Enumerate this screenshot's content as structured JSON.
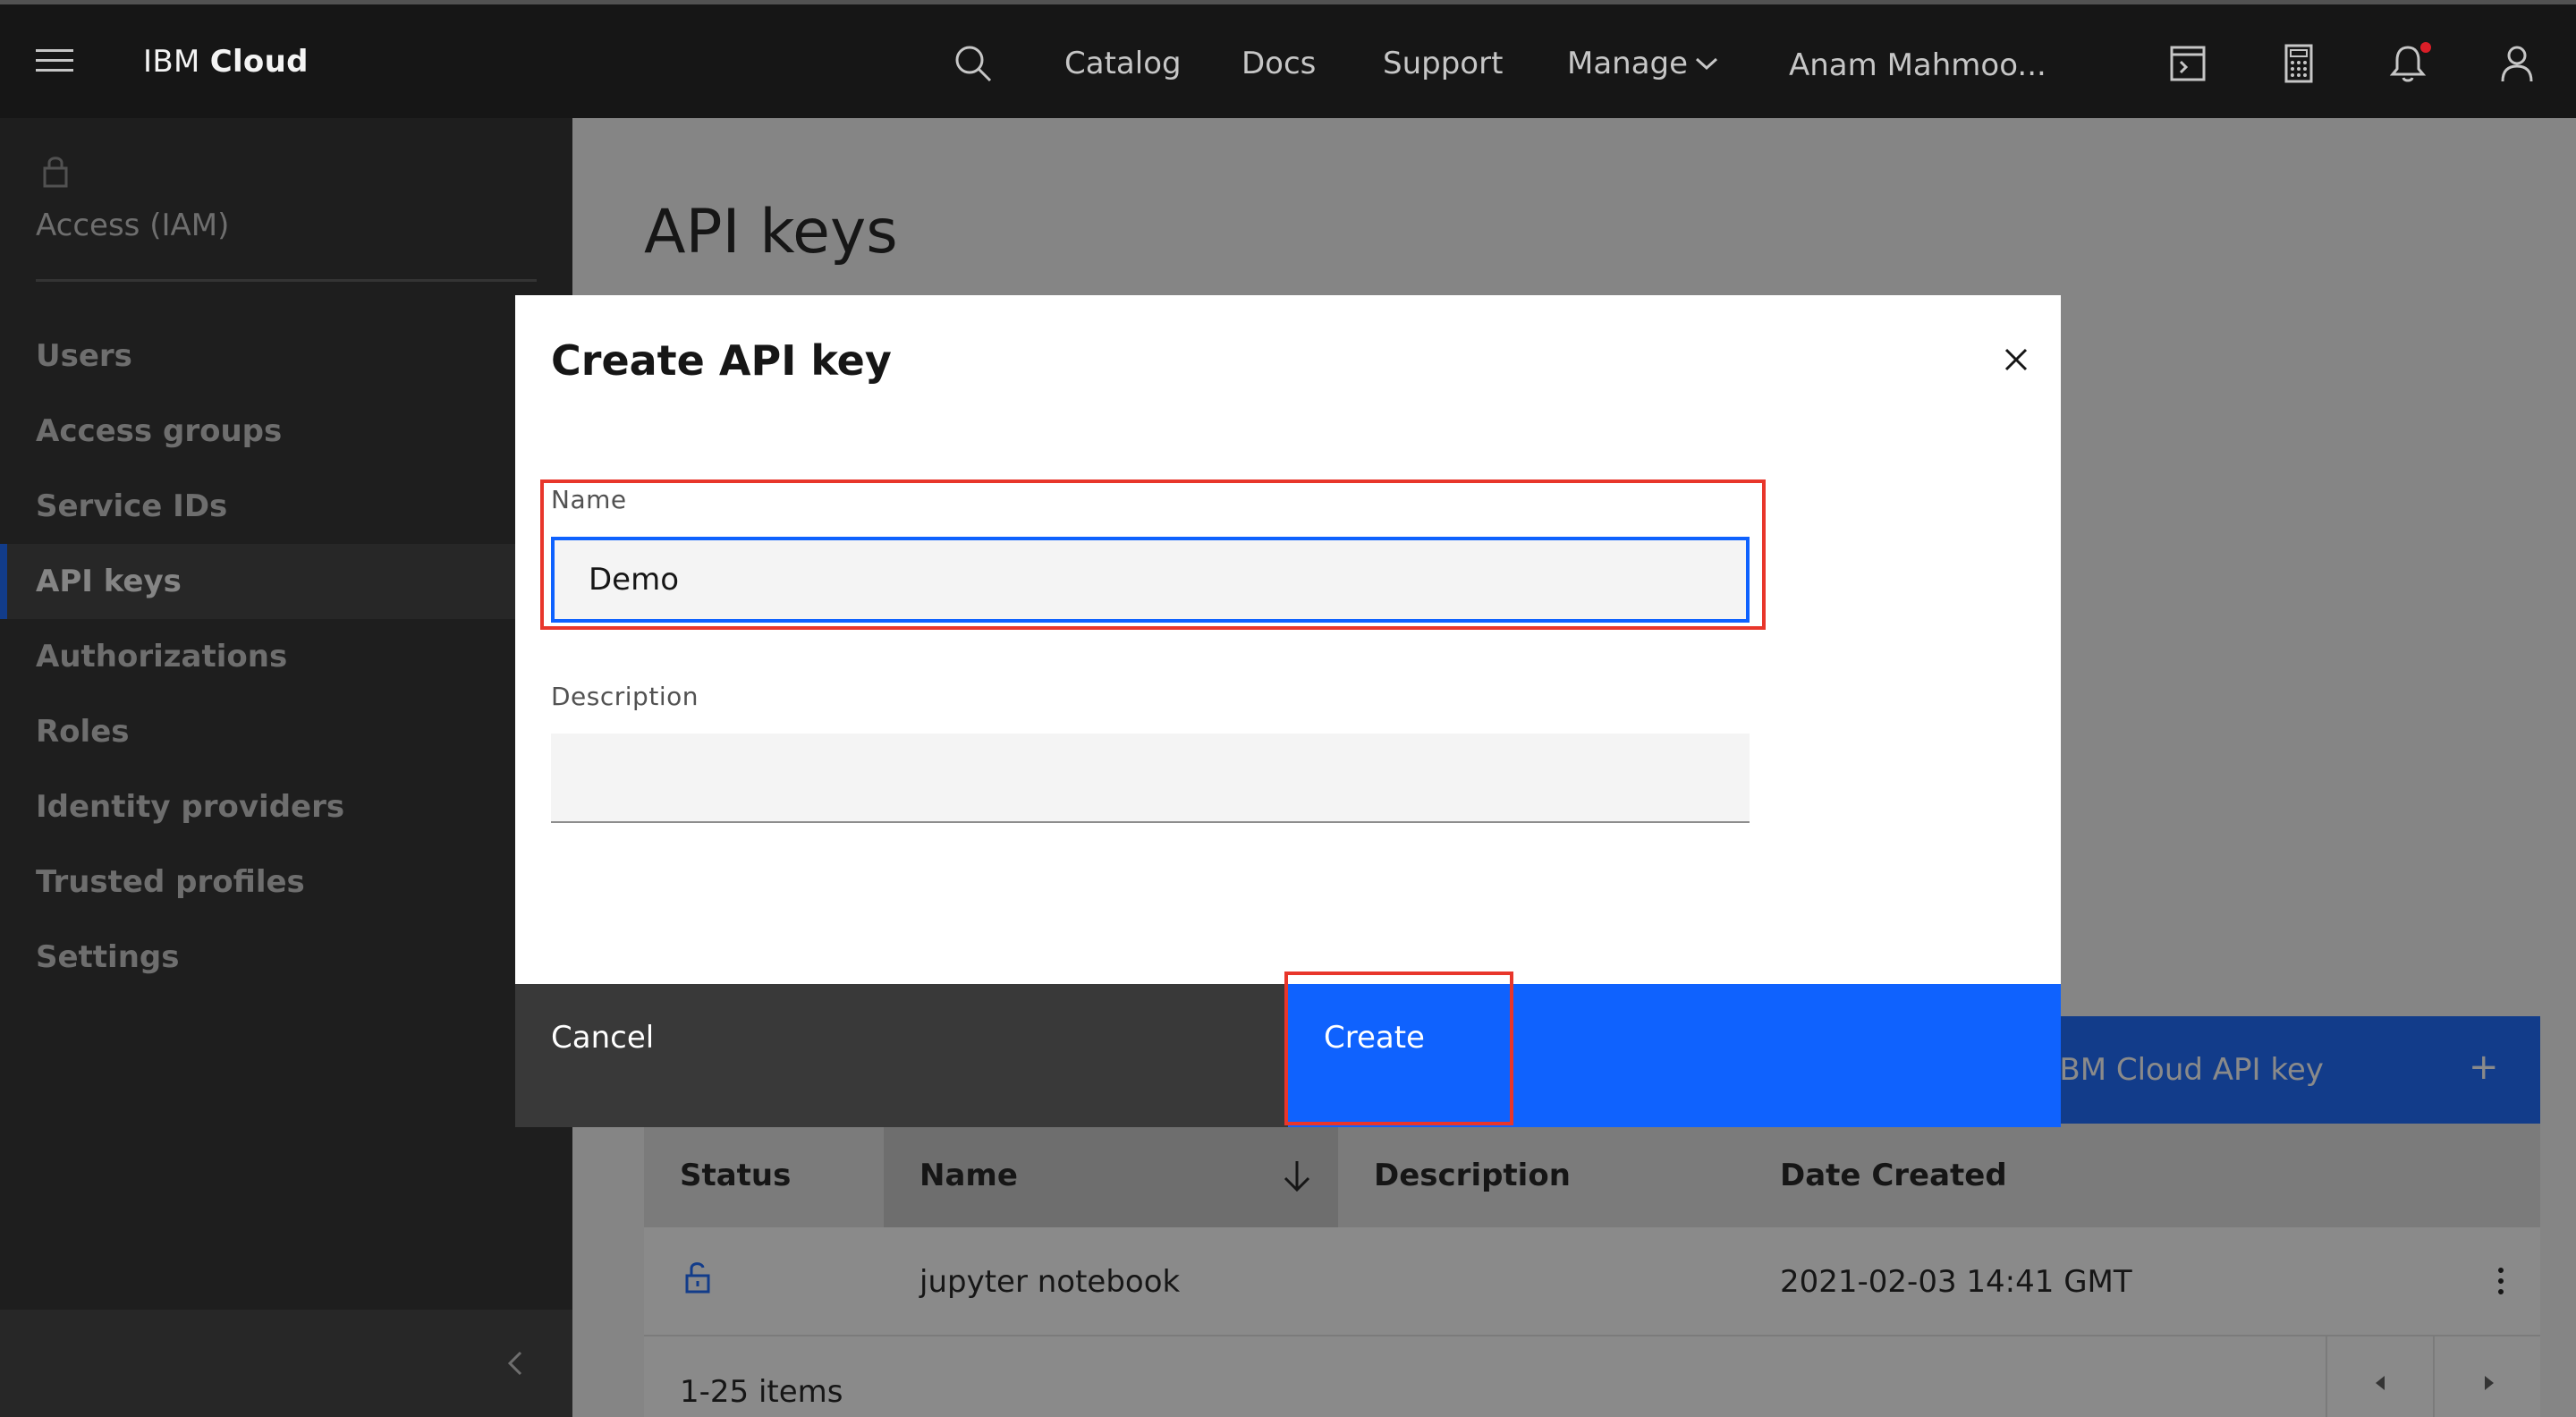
{
  "header": {
    "brand_prefix": "IBM",
    "brand_name": "Cloud",
    "nav": [
      "Catalog",
      "Docs",
      "Support"
    ],
    "manage_label": "Manage",
    "user_label": "Anam Mahmoo..."
  },
  "sidebar": {
    "title": "Access (IAM)",
    "items": [
      {
        "label": "Users"
      },
      {
        "label": "Access groups"
      },
      {
        "label": "Service IDs"
      },
      {
        "label": "API keys"
      },
      {
        "label": "Authorizations"
      },
      {
        "label": "Roles"
      },
      {
        "label": "Identity providers"
      },
      {
        "label": "Trusted profiles"
      },
      {
        "label": "Settings"
      }
    ],
    "active_item": "API keys"
  },
  "main": {
    "page_title": "API keys",
    "create_button_label": "n IBM Cloud API key",
    "create_button_plus": "+",
    "table": {
      "headers": [
        "Status",
        "Name",
        "Description",
        "Date Created"
      ],
      "rows": [
        {
          "name": "jupyter notebook",
          "description": "",
          "date_created": "2021-02-03 14:41 GMT"
        }
      ],
      "items_count": "1-25 items"
    }
  },
  "modal": {
    "title": "Create API key",
    "name_label": "Name",
    "name_value": "Demo",
    "description_label": "Description",
    "description_value": "",
    "cancel_label": "Cancel",
    "create_label": "Create"
  },
  "colors": {
    "accent": "#0f62fe",
    "highlight": "#e8362b",
    "header_bg": "#161616",
    "sidebar_bg": "#262626"
  }
}
